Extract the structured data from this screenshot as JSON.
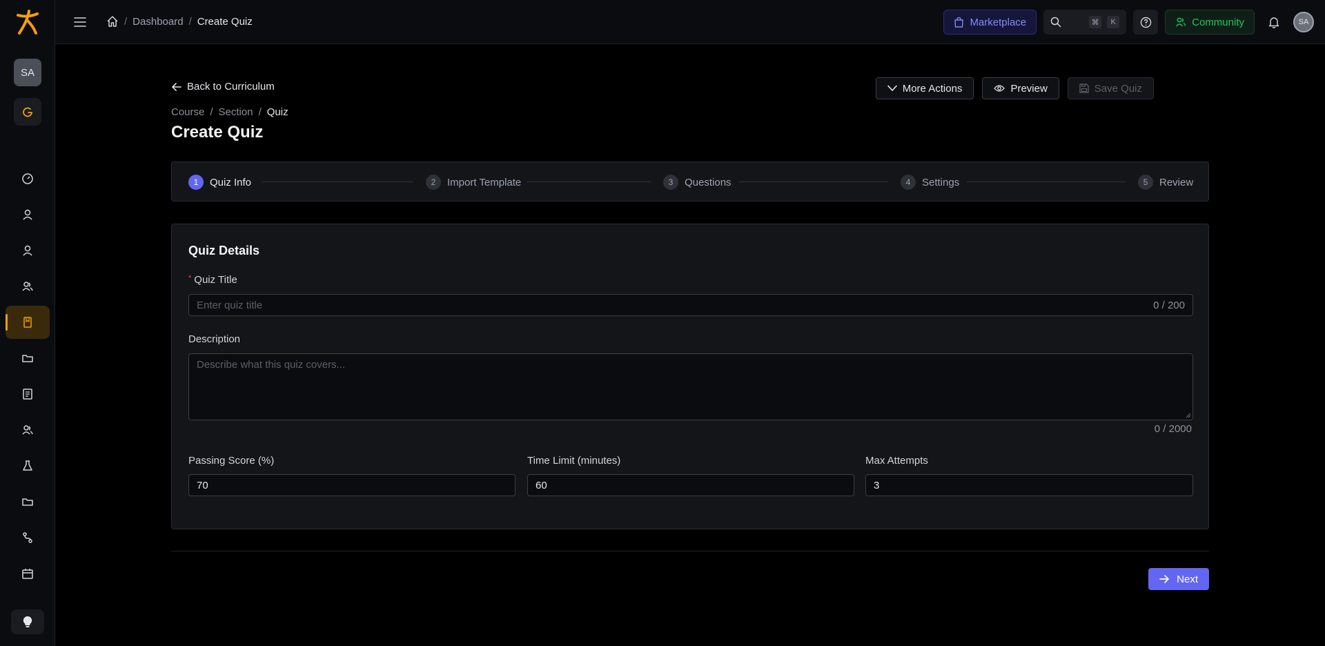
{
  "sidebar": {
    "avatar_initials": "SA",
    "nav_icons": [
      "dashboard-icon",
      "user-icon",
      "user-icon",
      "users-icon",
      "book-icon",
      "folder-icon",
      "receipt-icon",
      "users-icon",
      "flask-icon",
      "folder-icon",
      "route-icon",
      "calendar-icon"
    ],
    "active_index": 4,
    "accent_color": "#f59e0b"
  },
  "topbar": {
    "breadcrumb": {
      "dashboard": "Dashboard",
      "current": "Create Quiz"
    },
    "marketplace_label": "Marketplace",
    "shortcut_key1": "⌘",
    "shortcut_key2": "K",
    "community_label": "Community",
    "avatar_initials": "SA"
  },
  "header": {
    "back_label": "Back to Curriculum",
    "breadcrumb": {
      "course": "Course",
      "section": "Section",
      "current": "Quiz"
    },
    "title": "Create Quiz",
    "more_actions_label": "More Actions",
    "preview_label": "Preview",
    "save_label": "Save Quiz"
  },
  "steps": [
    {
      "num": "1",
      "label": "Quiz Info",
      "active": true
    },
    {
      "num": "2",
      "label": "Import Template",
      "active": false
    },
    {
      "num": "3",
      "label": "Questions",
      "active": false
    },
    {
      "num": "4",
      "label": "Settings",
      "active": false
    },
    {
      "num": "5",
      "label": "Review",
      "active": false
    }
  ],
  "form": {
    "section_title": "Quiz Details",
    "title_label": "Quiz Title",
    "title_required_mark": "*",
    "title_placeholder": "Enter quiz title",
    "title_counter": "0 / 200",
    "description_label": "Description",
    "description_placeholder": "Describe what this quiz covers...",
    "description_counter": "0 / 2000",
    "passing_label": "Passing Score (%)",
    "passing_value": "70",
    "time_label": "Time Limit (minutes)",
    "time_value": "60",
    "attempts_label": "Max Attempts",
    "attempts_value": "3"
  },
  "footer": {
    "next_label": "Next"
  },
  "colors": {
    "primary": "#6366f1",
    "marketplace": "#818cf8",
    "community": "#22c55e",
    "background": "#000000"
  }
}
